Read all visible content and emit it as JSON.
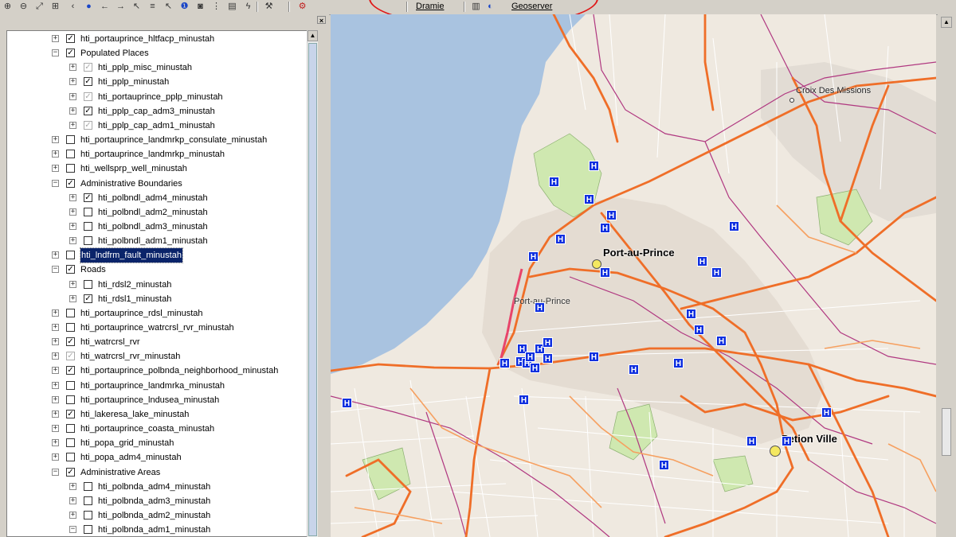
{
  "toolbar": {
    "icons": [
      "zoom-in-icon",
      "zoom-out-icon",
      "full-extent-icon",
      "zoom-layer-icon",
      "back-icon",
      "globe-icon",
      "left-arrow-icon",
      "right-arrow-icon",
      "select-icon",
      "identify-icon",
      "pointer-icon",
      "info-icon",
      "binoculars-icon",
      "measure-icon",
      "report-icon",
      "lightning-icon",
      "tool-icon",
      "gear-icon",
      "db-icon",
      "geoserver-icon"
    ],
    "drafts_label": "Dramie",
    "geoserver_label": "Geoserver"
  },
  "layer_tree": {
    "rows": [
      {
        "level": 1,
        "expander": "+",
        "check": "checked",
        "label": "hti_portauprince_hltfacp_minustah"
      },
      {
        "level": 1,
        "expander": "-",
        "check": "checked",
        "label": "Populated Places"
      },
      {
        "level": 2,
        "expander": "+",
        "check": "gray",
        "label": "hti_pplp_misc_minustah"
      },
      {
        "level": 2,
        "expander": "+",
        "check": "checked",
        "label": "hti_pplp_minustah"
      },
      {
        "level": 2,
        "expander": "+",
        "check": "gray",
        "label": "hti_portauprince_pplp_minustah"
      },
      {
        "level": 2,
        "expander": "+",
        "check": "checked",
        "label": "hti_pplp_cap_adm3_minustah"
      },
      {
        "level": 2,
        "expander": "+",
        "check": "gray",
        "label": "hti_pplp_cap_adm1_minustah"
      },
      {
        "level": 1,
        "expander": "+",
        "check": "unchecked",
        "label": "hti_portauprince_landmrkp_consulate_minustah"
      },
      {
        "level": 1,
        "expander": "+",
        "check": "unchecked",
        "label": "hti_portauprince_landmrkp_minustah"
      },
      {
        "level": 1,
        "expander": "+",
        "check": "unchecked",
        "label": "hti_wellsprp_well_minustah"
      },
      {
        "level": 1,
        "expander": "-",
        "check": "checked",
        "label": "Administrative Boundaries"
      },
      {
        "level": 2,
        "expander": "+",
        "check": "checked",
        "label": "hti_polbndl_adm4_minustah"
      },
      {
        "level": 2,
        "expander": "+",
        "check": "unchecked",
        "label": "hti_polbndl_adm2_minustah"
      },
      {
        "level": 2,
        "expander": "+",
        "check": "unchecked",
        "label": "hti_polbndl_adm3_minustah"
      },
      {
        "level": 2,
        "expander": "+",
        "check": "unchecked",
        "label": "hti_polbndl_adm1_minustah"
      },
      {
        "level": 1,
        "expander": "+",
        "check": "unchecked",
        "label": "hti_lndfrm_fault_minustah",
        "selected": true
      },
      {
        "level": 1,
        "expander": "-",
        "check": "checked",
        "label": "Roads"
      },
      {
        "level": 2,
        "expander": "+",
        "check": "unchecked",
        "label": "hti_rdsl2_minustah"
      },
      {
        "level": 2,
        "expander": "+",
        "check": "checked",
        "label": "hti_rdsl1_minustah"
      },
      {
        "level": 1,
        "expander": "+",
        "check": "unchecked",
        "label": "hti_portauprince_rdsl_minustah"
      },
      {
        "level": 1,
        "expander": "+",
        "check": "unchecked",
        "label": "hti_portauprince_watrcrsl_rvr_minustah"
      },
      {
        "level": 1,
        "expander": "+",
        "check": "checked",
        "label": "hti_watrcrsl_rvr"
      },
      {
        "level": 1,
        "expander": "+",
        "check": "gray",
        "label": "hti_watrcrsl_rvr_minustah"
      },
      {
        "level": 1,
        "expander": "+",
        "check": "checked",
        "label": "hti_portauprince_polbnda_neighborhood_minustah"
      },
      {
        "level": 1,
        "expander": "+",
        "check": "unchecked",
        "label": "hti_portauprince_landmrka_minustah"
      },
      {
        "level": 1,
        "expander": "+",
        "check": "unchecked",
        "label": "hti_portauprince_lndusea_minustah"
      },
      {
        "level": 1,
        "expander": "+",
        "check": "checked",
        "label": "hti_lakeresa_lake_minustah"
      },
      {
        "level": 1,
        "expander": "+",
        "check": "unchecked",
        "label": "hti_portauprince_coasta_minustah"
      },
      {
        "level": 1,
        "expander": "+",
        "check": "unchecked",
        "label": "hti_popa_grid_minustah"
      },
      {
        "level": 1,
        "expander": "+",
        "check": "unchecked",
        "label": "hti_popa_adm4_minustah"
      },
      {
        "level": 1,
        "expander": "-",
        "check": "checked",
        "label": "Administrative Areas"
      },
      {
        "level": 2,
        "expander": "+",
        "check": "unchecked",
        "label": "hti_polbnda_adm4_minustah"
      },
      {
        "level": 2,
        "expander": "+",
        "check": "unchecked",
        "label": "hti_polbnda_adm3_minustah"
      },
      {
        "level": 2,
        "expander": "+",
        "check": "unchecked",
        "label": "hti_polbnda_adm2_minustah"
      },
      {
        "level": 2,
        "expander": "-",
        "check": "unchecked",
        "label": "hti_polbnda_adm1_minustah"
      }
    ]
  },
  "map": {
    "place_labels": {
      "port_au_prince": "Port-au-Prince",
      "port_au_prince_small": "Port-au-Prince",
      "petion_ville": "Petion Ville",
      "croix_des_missions": "Croix Des Missions"
    },
    "hospital_glyph": "H",
    "hospital_count": 33,
    "colors": {
      "sea": "#a9c3e0",
      "land": "#efe9e0",
      "urban": "#e2dcd4",
      "major_road": "#ef6e28",
      "boundary": "#b03880",
      "park": "#cfe8b0",
      "hospital": "#1030e0",
      "selection_ellipse": "#e01818"
    }
  }
}
